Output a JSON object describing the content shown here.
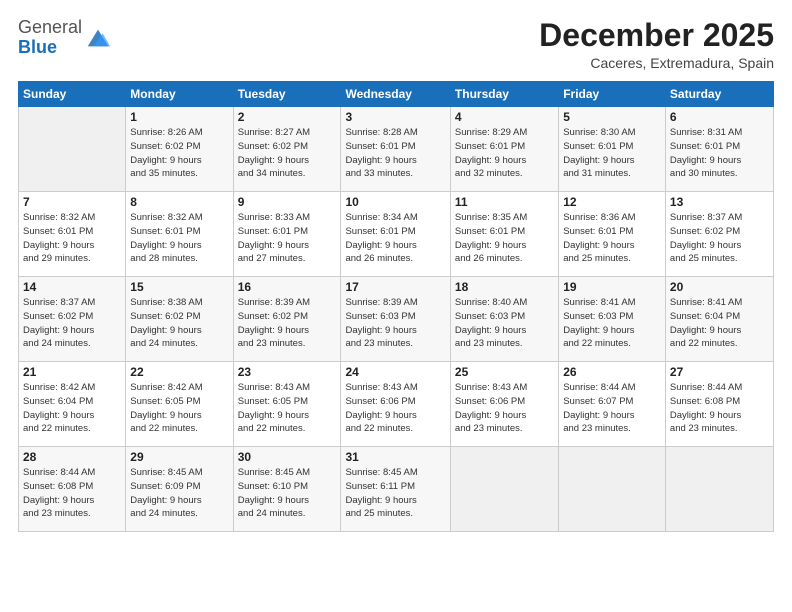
{
  "header": {
    "logo_general": "General",
    "logo_blue": "Blue",
    "month_title": "December 2025",
    "location": "Caceres, Extremadura, Spain"
  },
  "weekdays": [
    "Sunday",
    "Monday",
    "Tuesday",
    "Wednesday",
    "Thursday",
    "Friday",
    "Saturday"
  ],
  "weeks": [
    [
      {
        "day": "",
        "info": ""
      },
      {
        "day": "1",
        "info": "Sunrise: 8:26 AM\nSunset: 6:02 PM\nDaylight: 9 hours\nand 35 minutes."
      },
      {
        "day": "2",
        "info": "Sunrise: 8:27 AM\nSunset: 6:02 PM\nDaylight: 9 hours\nand 34 minutes."
      },
      {
        "day": "3",
        "info": "Sunrise: 8:28 AM\nSunset: 6:01 PM\nDaylight: 9 hours\nand 33 minutes."
      },
      {
        "day": "4",
        "info": "Sunrise: 8:29 AM\nSunset: 6:01 PM\nDaylight: 9 hours\nand 32 minutes."
      },
      {
        "day": "5",
        "info": "Sunrise: 8:30 AM\nSunset: 6:01 PM\nDaylight: 9 hours\nand 31 minutes."
      },
      {
        "day": "6",
        "info": "Sunrise: 8:31 AM\nSunset: 6:01 PM\nDaylight: 9 hours\nand 30 minutes."
      }
    ],
    [
      {
        "day": "7",
        "info": "Sunrise: 8:32 AM\nSunset: 6:01 PM\nDaylight: 9 hours\nand 29 minutes."
      },
      {
        "day": "8",
        "info": "Sunrise: 8:32 AM\nSunset: 6:01 PM\nDaylight: 9 hours\nand 28 minutes."
      },
      {
        "day": "9",
        "info": "Sunrise: 8:33 AM\nSunset: 6:01 PM\nDaylight: 9 hours\nand 27 minutes."
      },
      {
        "day": "10",
        "info": "Sunrise: 8:34 AM\nSunset: 6:01 PM\nDaylight: 9 hours\nand 26 minutes."
      },
      {
        "day": "11",
        "info": "Sunrise: 8:35 AM\nSunset: 6:01 PM\nDaylight: 9 hours\nand 26 minutes."
      },
      {
        "day": "12",
        "info": "Sunrise: 8:36 AM\nSunset: 6:01 PM\nDaylight: 9 hours\nand 25 minutes."
      },
      {
        "day": "13",
        "info": "Sunrise: 8:37 AM\nSunset: 6:02 PM\nDaylight: 9 hours\nand 25 minutes."
      }
    ],
    [
      {
        "day": "14",
        "info": "Sunrise: 8:37 AM\nSunset: 6:02 PM\nDaylight: 9 hours\nand 24 minutes."
      },
      {
        "day": "15",
        "info": "Sunrise: 8:38 AM\nSunset: 6:02 PM\nDaylight: 9 hours\nand 24 minutes."
      },
      {
        "day": "16",
        "info": "Sunrise: 8:39 AM\nSunset: 6:02 PM\nDaylight: 9 hours\nand 23 minutes."
      },
      {
        "day": "17",
        "info": "Sunrise: 8:39 AM\nSunset: 6:03 PM\nDaylight: 9 hours\nand 23 minutes."
      },
      {
        "day": "18",
        "info": "Sunrise: 8:40 AM\nSunset: 6:03 PM\nDaylight: 9 hours\nand 23 minutes."
      },
      {
        "day": "19",
        "info": "Sunrise: 8:41 AM\nSunset: 6:03 PM\nDaylight: 9 hours\nand 22 minutes."
      },
      {
        "day": "20",
        "info": "Sunrise: 8:41 AM\nSunset: 6:04 PM\nDaylight: 9 hours\nand 22 minutes."
      }
    ],
    [
      {
        "day": "21",
        "info": "Sunrise: 8:42 AM\nSunset: 6:04 PM\nDaylight: 9 hours\nand 22 minutes."
      },
      {
        "day": "22",
        "info": "Sunrise: 8:42 AM\nSunset: 6:05 PM\nDaylight: 9 hours\nand 22 minutes."
      },
      {
        "day": "23",
        "info": "Sunrise: 8:43 AM\nSunset: 6:05 PM\nDaylight: 9 hours\nand 22 minutes."
      },
      {
        "day": "24",
        "info": "Sunrise: 8:43 AM\nSunset: 6:06 PM\nDaylight: 9 hours\nand 22 minutes."
      },
      {
        "day": "25",
        "info": "Sunrise: 8:43 AM\nSunset: 6:06 PM\nDaylight: 9 hours\nand 23 minutes."
      },
      {
        "day": "26",
        "info": "Sunrise: 8:44 AM\nSunset: 6:07 PM\nDaylight: 9 hours\nand 23 minutes."
      },
      {
        "day": "27",
        "info": "Sunrise: 8:44 AM\nSunset: 6:08 PM\nDaylight: 9 hours\nand 23 minutes."
      }
    ],
    [
      {
        "day": "28",
        "info": "Sunrise: 8:44 AM\nSunset: 6:08 PM\nDaylight: 9 hours\nand 23 minutes."
      },
      {
        "day": "29",
        "info": "Sunrise: 8:45 AM\nSunset: 6:09 PM\nDaylight: 9 hours\nand 24 minutes."
      },
      {
        "day": "30",
        "info": "Sunrise: 8:45 AM\nSunset: 6:10 PM\nDaylight: 9 hours\nand 24 minutes."
      },
      {
        "day": "31",
        "info": "Sunrise: 8:45 AM\nSunset: 6:11 PM\nDaylight: 9 hours\nand 25 minutes."
      },
      {
        "day": "",
        "info": ""
      },
      {
        "day": "",
        "info": ""
      },
      {
        "day": "",
        "info": ""
      }
    ]
  ]
}
